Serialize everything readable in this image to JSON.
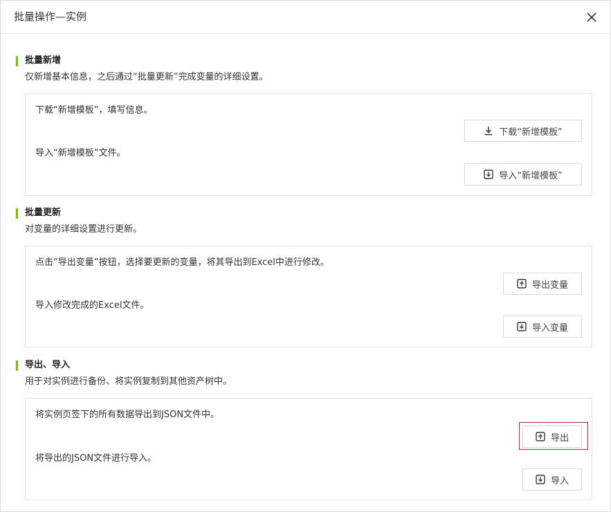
{
  "dialog": {
    "title": "批量操作—实例"
  },
  "sections": [
    {
      "title": "批量新增",
      "desc": "仅新增基本信息，之后通过“批量更新”完成变量的详细设置。",
      "rows": [
        {
          "text": "下载“新增模板”，填写信息。",
          "button": "下载“新增模板”",
          "icon": "download-icon"
        },
        {
          "text": "导入“新增模板”文件。",
          "button": "导入“新增模板”",
          "icon": "import-icon"
        }
      ]
    },
    {
      "title": "批量更新",
      "desc": "对变量的详细设置进行更新。",
      "rows": [
        {
          "text": "点击“导出变量”按钮，选择要更新的变量，将其导出到Excel中进行修改。",
          "button": "导出变量",
          "icon": "export-icon"
        },
        {
          "text": "导入修改完成的Excel文件。",
          "button": "导入变量",
          "icon": "import-icon"
        }
      ]
    },
    {
      "title": "导出、导入",
      "desc": "用于对实例进行备份、将实例复制到其他资产树中。",
      "rows": [
        {
          "text": "将实例页签下的所有数据导出到JSON文件中。",
          "button": "导出",
          "icon": "export-icon"
        },
        {
          "text": "将导出的JSON文件进行导入。",
          "button": "导入",
          "icon": "import-icon"
        }
      ]
    }
  ],
  "colors": {
    "accent": "#73c000",
    "highlight": "#b0253a",
    "border": "#d9d9d9"
  }
}
